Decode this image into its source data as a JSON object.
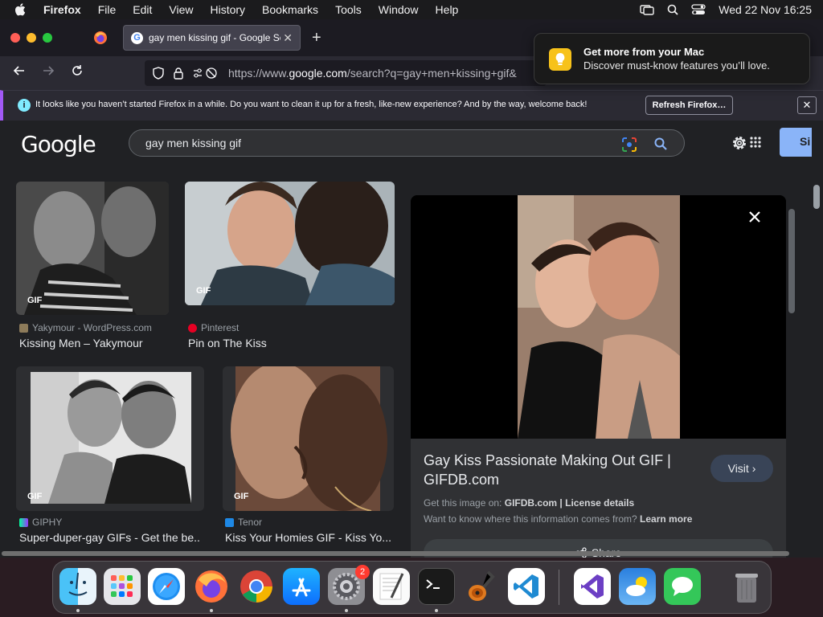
{
  "menubar": {
    "app_name": "Firefox",
    "items": [
      "File",
      "Edit",
      "View",
      "History",
      "Bookmarks",
      "Tools",
      "Window",
      "Help"
    ],
    "datetime": "Wed 22 Nov  16:25"
  },
  "browser": {
    "tab_title": "gay men kissing gif - Google Se",
    "url_prefix": "https://www.",
    "url_domain": "google.com",
    "url_path": "/search?q=gay+men+kissing+gif&",
    "notification": {
      "title": "Get more from your Mac",
      "body": "Discover must-know features you’ll love."
    },
    "infobar": {
      "message": "It looks like you haven’t started Firefox in a while. Do you want to clean it up for a fresh, like-new experience? And by the way, welcome back!",
      "button": "Refresh Firefox…"
    }
  },
  "google": {
    "logo": "Google",
    "query": "gay men kissing gif",
    "signin_label": "Si",
    "gif_label": "GIF",
    "results": [
      {
        "source": "Yakymour - WordPress.com",
        "title": "Kissing Men – Yakymour"
      },
      {
        "source": "Pinterest",
        "title": "Pin on The Kiss"
      },
      {
        "source": "GIPHY",
        "title": "Super-duper-gay GIFs - Get the be..."
      },
      {
        "source": "Tenor",
        "title": "Kiss Your Homies GIF - Kiss Yo..."
      }
    ],
    "panel": {
      "title": "Gay Kiss Passionate Making Out GIF | GIFDB.com",
      "visit": "Visit",
      "get_image_prefix": "Get this image on:",
      "get_image_site": "GIFDB.com",
      "separator": "|",
      "license": "License details",
      "want_to_know": "Want to know where this information comes from?",
      "learn_more": "Learn more",
      "share": "Share"
    }
  },
  "dock": {
    "settings_badge": "2"
  },
  "colors": {
    "accent_blue": "#8ab4f8",
    "infobar_stripe": "#a259f7",
    "notification_bulb": "#f7c21a"
  }
}
